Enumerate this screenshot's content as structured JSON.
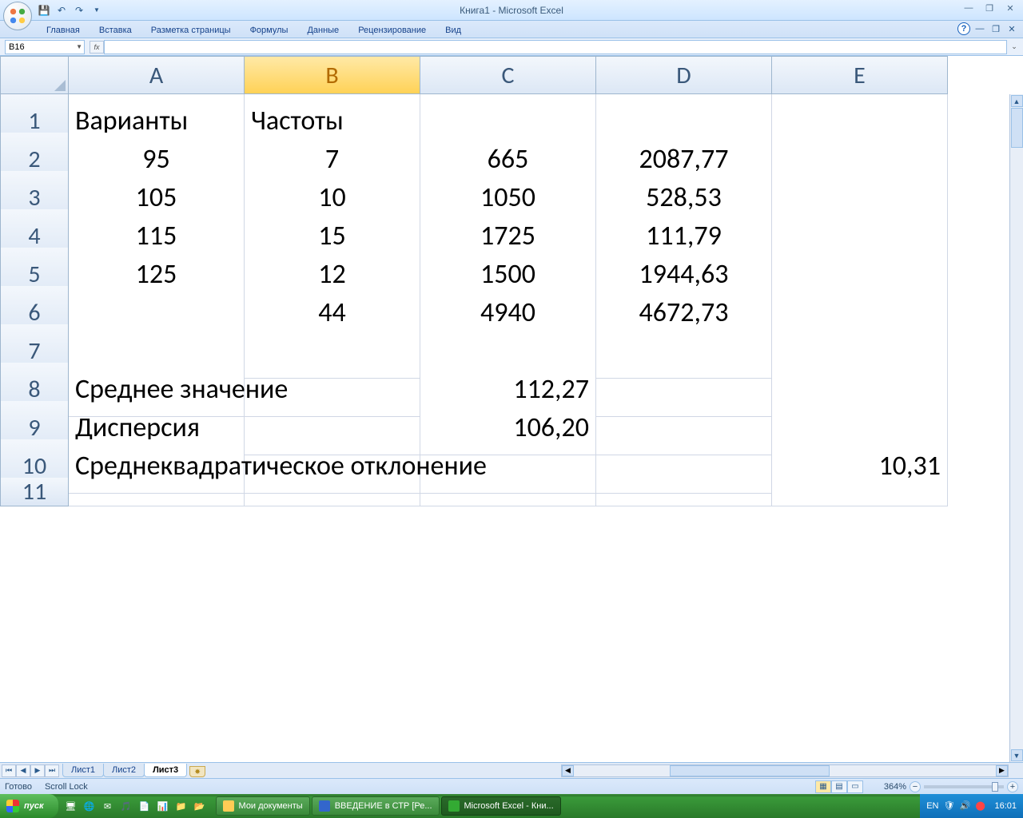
{
  "window": {
    "title": "Книга1 - Microsoft Excel"
  },
  "ribbon": {
    "tabs": [
      "Главная",
      "Вставка",
      "Разметка страницы",
      "Формулы",
      "Данные",
      "Рецензирование",
      "Вид"
    ],
    "active": 0
  },
  "namebox": {
    "value": "B16"
  },
  "formula": {
    "value": ""
  },
  "columns": [
    "A",
    "B",
    "C",
    "D",
    "E"
  ],
  "selected_col": "B",
  "rows": [
    {
      "n": "1",
      "A": "Варианты",
      "B": "Частоты",
      "C": "",
      "D": "",
      "E": "",
      "align": {
        "A": "left",
        "B": "left"
      }
    },
    {
      "n": "2",
      "A": "95",
      "B": "7",
      "C": "665",
      "D": "2087,77",
      "E": ""
    },
    {
      "n": "3",
      "A": "105",
      "B": "10",
      "C": "1050",
      "D": "528,53",
      "E": ""
    },
    {
      "n": "4",
      "A": "115",
      "B": "15",
      "C": "1725",
      "D": "111,79",
      "E": ""
    },
    {
      "n": "5",
      "A": "125",
      "B": "12",
      "C": "1500",
      "D": "1944,63",
      "E": ""
    },
    {
      "n": "6",
      "A": "",
      "B": "44",
      "C": "4940",
      "D": "4672,73",
      "E": ""
    },
    {
      "n": "7",
      "A": "",
      "B": "",
      "C": "",
      "D": "",
      "E": ""
    },
    {
      "n": "8",
      "A": "Среднее значение",
      "B": "",
      "C": "112,27",
      "D": "",
      "E": "",
      "overflowA": true,
      "alignC": "right"
    },
    {
      "n": "9",
      "A": "Дисперсия",
      "B": "",
      "C": "106,20",
      "D": "",
      "E": "",
      "alignC": "right"
    },
    {
      "n": "10",
      "A": "Среднеквадратическое отклонение",
      "B": "",
      "C": "",
      "D": "",
      "E": "10,31",
      "overflowA": true,
      "alignE": "right"
    },
    {
      "n": "11",
      "A": "",
      "B": "",
      "C": "",
      "D": "",
      "E": ""
    }
  ],
  "sheets": {
    "tabs": [
      "Лист1",
      "Лист2",
      "Лист3"
    ],
    "active": 2
  },
  "status": {
    "ready": "Готово",
    "scroll": "Scroll Lock",
    "zoom": "364%"
  },
  "taskbar": {
    "start": "пуск",
    "buttons": [
      {
        "label": "Мои документы",
        "active": false
      },
      {
        "label": "ВВЕДЕНИЕ в СТР [Ре...",
        "active": false
      },
      {
        "label": "Microsoft Excel - Кни...",
        "active": true
      }
    ],
    "lang": "EN",
    "clock": "16:01"
  }
}
